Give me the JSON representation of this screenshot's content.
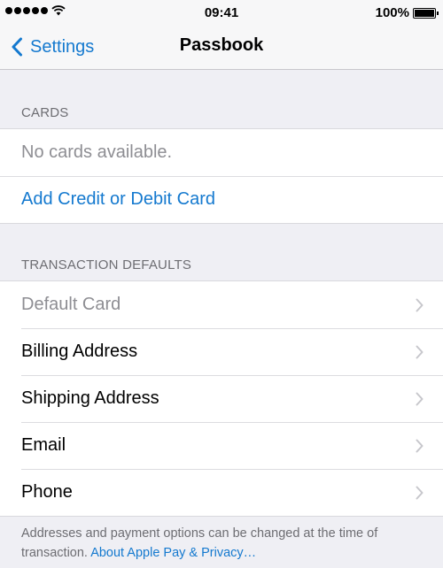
{
  "status_bar": {
    "time": "09:41",
    "battery": "100%",
    "battery_level": 1.0,
    "signal_bars": 5
  },
  "nav": {
    "back_label": "Settings",
    "title": "Passbook"
  },
  "cards_section": {
    "header": "CARDS",
    "empty_text": "No cards available.",
    "add_label": "Add Credit or Debit Card"
  },
  "defaults_section": {
    "header": "TRANSACTION DEFAULTS",
    "items": [
      {
        "label": "Default Card",
        "disabled": true
      },
      {
        "label": "Billing Address",
        "disabled": false
      },
      {
        "label": "Shipping Address",
        "disabled": false
      },
      {
        "label": "Email",
        "disabled": false
      },
      {
        "label": "Phone",
        "disabled": false
      }
    ]
  },
  "footer": {
    "text": "Addresses and payment options can be changed at the time of transaction. ",
    "link": "About Apple Pay & Privacy…"
  },
  "colors": {
    "accent": "#1479cf",
    "background": "#efeff4",
    "secondary_text": "#6d6d72"
  },
  "icons": {
    "back": "chevron-left-icon",
    "row_disclosure": "chevron-right-icon",
    "wifi": "wifi-icon",
    "battery": "battery-icon"
  }
}
